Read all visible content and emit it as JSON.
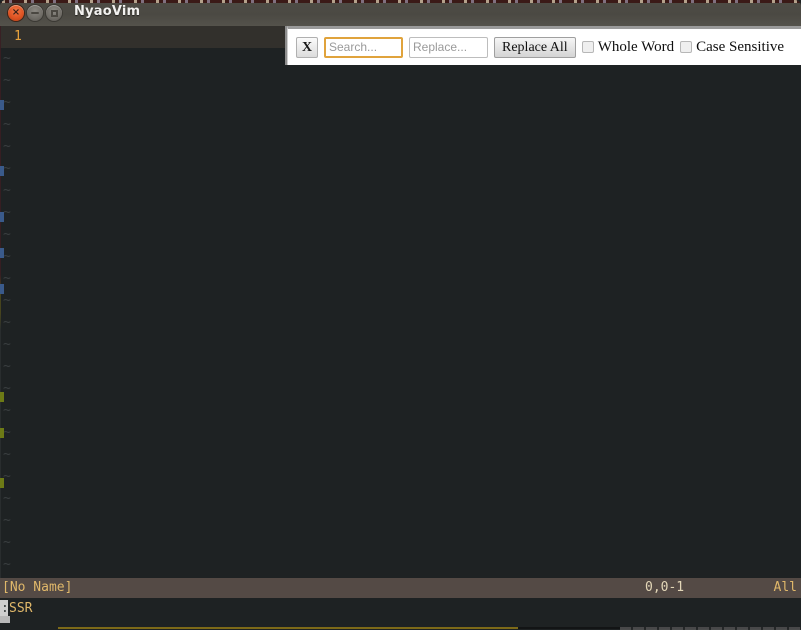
{
  "window": {
    "title": "NyaoVim",
    "controls": [
      {
        "name": "close",
        "glyph": "×"
      },
      {
        "name": "minimize",
        "glyph": "−"
      },
      {
        "name": "maximize",
        "glyph": "□"
      }
    ]
  },
  "editor": {
    "line_number": "1",
    "tilde_marker": "~",
    "tilde_rows": 24,
    "background_color": "#1e2223",
    "cursor_line_color": "#32302c",
    "line_number_color": "#e8a33d"
  },
  "statusline": {
    "file": "[No Name]",
    "position": "0,0-1",
    "scroll": "All",
    "background_color": "#544a45",
    "text_color": "#e0b86a"
  },
  "commandline": {
    "prompt": ":",
    "text": "SSR",
    "text_color": "#e0b86a"
  },
  "search_replace_toolbar": {
    "close_label": "X",
    "search": {
      "value": "",
      "placeholder": "Search...",
      "focused": true,
      "focus_border_color": "#e0a33c"
    },
    "replace": {
      "value": "",
      "placeholder": "Replace..."
    },
    "replace_all_label": "Replace All",
    "options": [
      {
        "label": "Whole Word",
        "checked": false
      },
      {
        "label": "Case Sensitive",
        "checked": false
      }
    ]
  }
}
